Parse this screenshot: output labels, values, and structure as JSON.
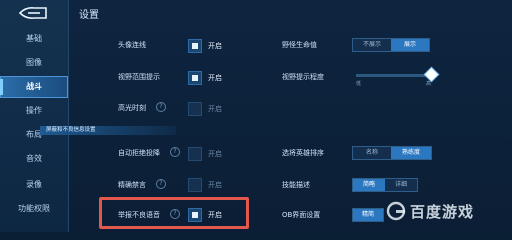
{
  "page": {
    "title": "设置"
  },
  "sidebar": {
    "items": [
      {
        "label": "基础"
      },
      {
        "label": "图像"
      },
      {
        "label": "战斗",
        "active": true
      },
      {
        "label": "操作"
      },
      {
        "label": "布局"
      },
      {
        "label": "音效"
      },
      {
        "label": "录像"
      },
      {
        "label": "功能权限"
      }
    ]
  },
  "settings": {
    "avatar_connect": {
      "label": "头像连线",
      "toggle": "开启",
      "checked": true
    },
    "vision_range_hint": {
      "label": "视野范围提示",
      "toggle": "开启",
      "checked": true
    },
    "highlight_moment": {
      "label": "高光时刻",
      "toggle": "开启",
      "checked": false
    },
    "auto_reject_vote": {
      "label": "自动拒绝投降",
      "toggle": "开启",
      "checked": false
    },
    "precise_ban": {
      "label": "精确禁言",
      "toggle": "开启",
      "checked": false
    },
    "report_bad_voice": {
      "label": "举报不良语音",
      "toggle": "开启",
      "checked": true
    },
    "wild_hp": {
      "label": "野怪生命值",
      "options": [
        "不展示",
        "展示"
      ],
      "selected": 1
    },
    "vision_hint_level": {
      "label": "视野提示程度",
      "min_label": "低",
      "max_label": "高",
      "value": 1.0
    },
    "hero_sort": {
      "label": "选将英雄排序",
      "options": [
        "名称",
        "熟练度"
      ],
      "selected": 1
    },
    "skill_desc": {
      "label": "技能描述",
      "options": [
        "简略",
        "详细"
      ],
      "selected": 0
    },
    "ob_ui": {
      "label": "OB界面设置",
      "options": [
        "精简"
      ],
      "selected": 0
    }
  },
  "section": {
    "label": "屏蔽和不良信息设置"
  },
  "watermark": {
    "text": "百度游戏"
  },
  "colors": {
    "accent": "#2b77c0",
    "highlight_box": "#e2584c",
    "background": "#0b1f33"
  }
}
